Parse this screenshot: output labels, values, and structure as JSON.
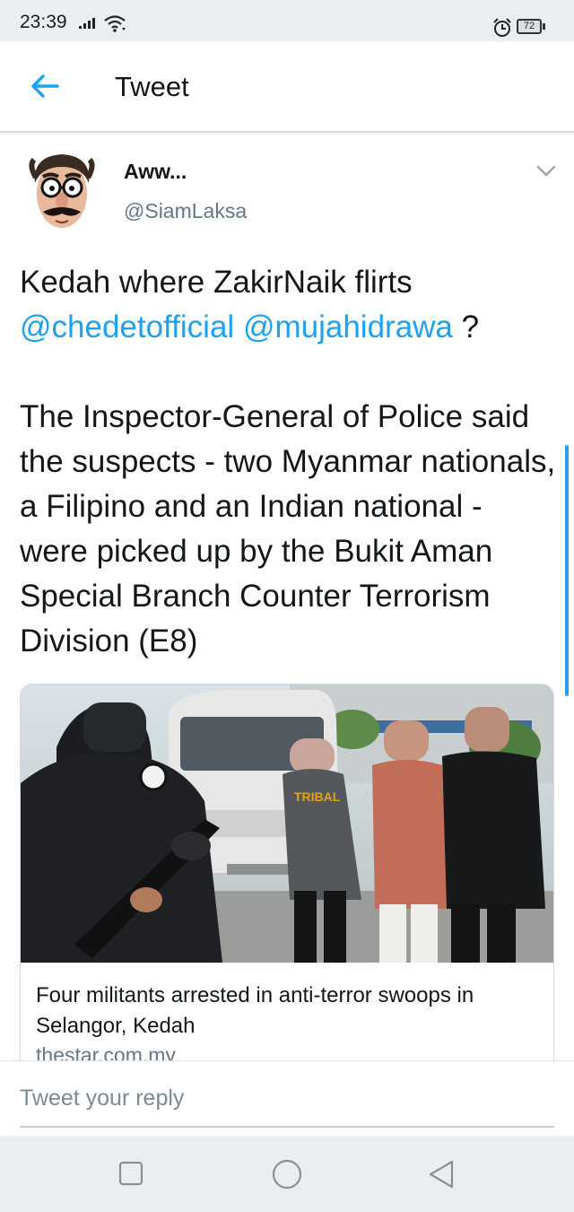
{
  "status_bar": {
    "time": "23:39",
    "battery": "72"
  },
  "app_bar": {
    "title": "Tweet",
    "back_icon": "back-arrow-icon"
  },
  "tweet": {
    "author_name": "Aww...",
    "author_handle": "@SiamLaksa",
    "text_line1": "Kedah where ZakirNaik flirts",
    "mention1": "@chedetofficial",
    "mention2": "@mujahidrawa",
    "question_mark": " ?",
    "body": "The Inspector-General of Police said the suspects - two Myanmar nationals, a Filipino and an Indian national - were picked up by the Bukit Aman Special Branch Counter Terrorism Division (E8)"
  },
  "link_card": {
    "title": "Four militants arrested in anti-terror swoops in Selangor, Kedah",
    "domain": "thestar.com.my"
  },
  "reply": {
    "placeholder": "Tweet your reply"
  },
  "colors": {
    "accent": "#1da1f2",
    "secondary_text": "#657786",
    "status_bar_bg": "#ebeef0"
  }
}
